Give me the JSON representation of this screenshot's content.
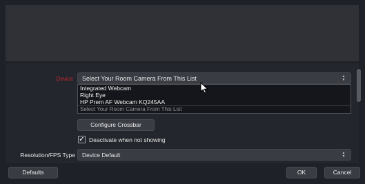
{
  "properties": {
    "device_label": "Device",
    "device_selected": "Select Your Room Camera From This List",
    "device_options": [
      "Integrated Webcam",
      "Right Eye",
      "HP Prem AF Webcam KQ245AA",
      "Select Your Room Camera From This List"
    ],
    "configure_crossbar_label": "Configure Crossbar",
    "deactivate_label": "Deactivate when not showing",
    "deactivate_checked": true,
    "resolution_label": "Resolution/FPS Type",
    "resolution_value": "Device Default"
  },
  "footer": {
    "defaults_label": "Defaults",
    "ok_label": "OK",
    "cancel_label": "Cancel"
  },
  "colors": {
    "background": "#1f2128",
    "panel": "#24262d",
    "preview": "#2f3136",
    "device_label": "#c0272d"
  },
  "icons": {
    "checkbox": "check-icon",
    "combo_arrows": "updown-arrows-icon",
    "cursor": "mouse-pointer-icon"
  }
}
